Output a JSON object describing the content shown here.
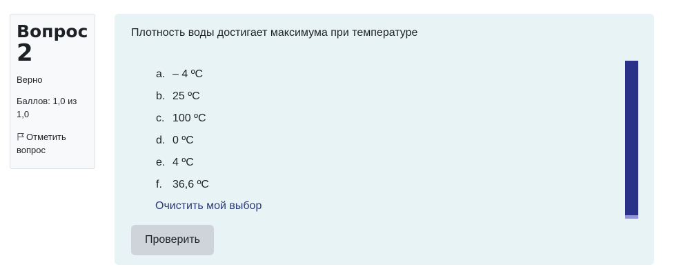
{
  "info": {
    "question_word": "Вопрос",
    "question_number": "2",
    "state": "Верно",
    "grade_line1": "Баллов: 1,0 из",
    "grade_line2": "1,0",
    "flag_line1": "Отметить",
    "flag_line2": "вопрос",
    "flag_icon": "flag-icon"
  },
  "question": {
    "text": "Плотность воды достигает максимума при температуре",
    "answers": [
      {
        "letter": "a.",
        "text": "– 4 ºС"
      },
      {
        "letter": "b.",
        "text": "25 ºС"
      },
      {
        "letter": "c.",
        "text": "100 ºС"
      },
      {
        "letter": "d.",
        "text": "0 ºС"
      },
      {
        "letter": "e.",
        "text": "4 ºС"
      },
      {
        "letter": "f.",
        "text": "36,6 ºС"
      }
    ],
    "clear_choice": "Очистить мой выбор",
    "check_button": "Проверить"
  },
  "colors": {
    "content_bg": "#e7f3f5",
    "accent_bar": "#293189",
    "link": "#2b3a74",
    "button_bg": "#ced4da"
  }
}
